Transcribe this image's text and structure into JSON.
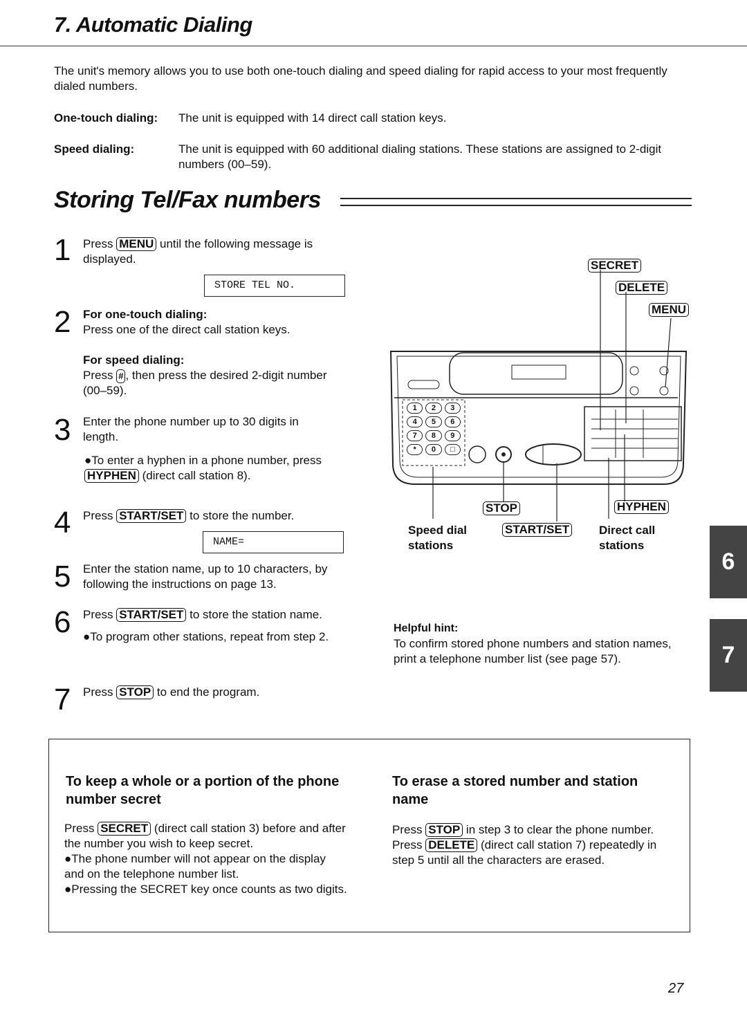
{
  "chapter_title": "7. Automatic Dialing",
  "intro": "The unit's memory allows you to use both one-touch dialing and speed dialing for rapid access to your most frequently dialed numbers.",
  "definitions": [
    {
      "term": "One-touch dialing:",
      "text": "The unit is equipped with 14 direct call station keys."
    },
    {
      "term": "Speed dialing:",
      "text": "The unit is equipped with 60 additional dialing stations. These stations are assigned to 2-digit numbers (00–59)."
    }
  ],
  "section_title": "Storing Tel/Fax numbers",
  "steps": {
    "s1": {
      "num": "1",
      "pre": "Press",
      "key": "MENU",
      "post": "until the following message is displayed.",
      "display": "STORE TEL NO."
    },
    "s2": {
      "num": "2",
      "h1": "For one-touch dialing:",
      "t1": "Press one of the direct call station keys.",
      "h2": "For speed dialing:",
      "pre": "Press",
      "key": "#",
      "post": ", then press the desired 2-digit number (00–59)."
    },
    "s3": {
      "num": "3",
      "text": "Enter the phone number up to 30 digits in length.",
      "bullet_pre": "●To enter a hyphen in a phone number, press",
      "key": "HYPHEN",
      "bullet_post": "(direct call station 8)."
    },
    "s4": {
      "num": "4",
      "pre": "Press",
      "key": "START/SET",
      "post": "to store the number.",
      "display": "NAME="
    },
    "s5": {
      "num": "5",
      "text": "Enter the station name, up to 10 characters, by following the instructions on page 13."
    },
    "s6": {
      "num": "6",
      "pre": "Press",
      "key": "START/SET",
      "post": "to store the station name.",
      "bullet": "●To program other stations, repeat from step 2."
    },
    "s7": {
      "num": "7",
      "pre": "Press",
      "key": "STOP",
      "post": "to end the program."
    }
  },
  "diagram": {
    "keys": {
      "secret": "SECRET",
      "delete": "DELETE",
      "menu": "MENU",
      "stop": "STOP",
      "start_set": "START/SET",
      "hyphen": "HYPHEN"
    },
    "labels": {
      "speed": "Speed dial stations",
      "direct": "Direct call stations"
    },
    "dial": [
      "1",
      "2",
      "3",
      "4",
      "5",
      "6",
      "7",
      "8",
      "9",
      "*",
      "0",
      "□"
    ]
  },
  "hint": {
    "title": "Helpful hint:",
    "text": "To confirm stored phone numbers and station names, print a telephone number list (see page 57)."
  },
  "box": {
    "left": {
      "title": "To keep a whole or a portion of the phone number secret",
      "pre": "Press",
      "key": "SECRET",
      "post": "(direct call station 3) before and after the number you wish to keep secret.",
      "b1": "●The phone number will not appear on the display and on the telephone number list.",
      "b2": "●Pressing the SECRET key once counts as two digits."
    },
    "right": {
      "title": "To erase a stored number and station name",
      "pre1": "Press",
      "key1": "STOP",
      "post1": "in step 3 to clear the phone number.",
      "pre2": "Press",
      "key2": "DELETE",
      "post2": "(direct call station 7) repeatedly in step 5 until all the characters are erased."
    }
  },
  "side_tabs": [
    "6",
    "7"
  ],
  "page_number": "27"
}
